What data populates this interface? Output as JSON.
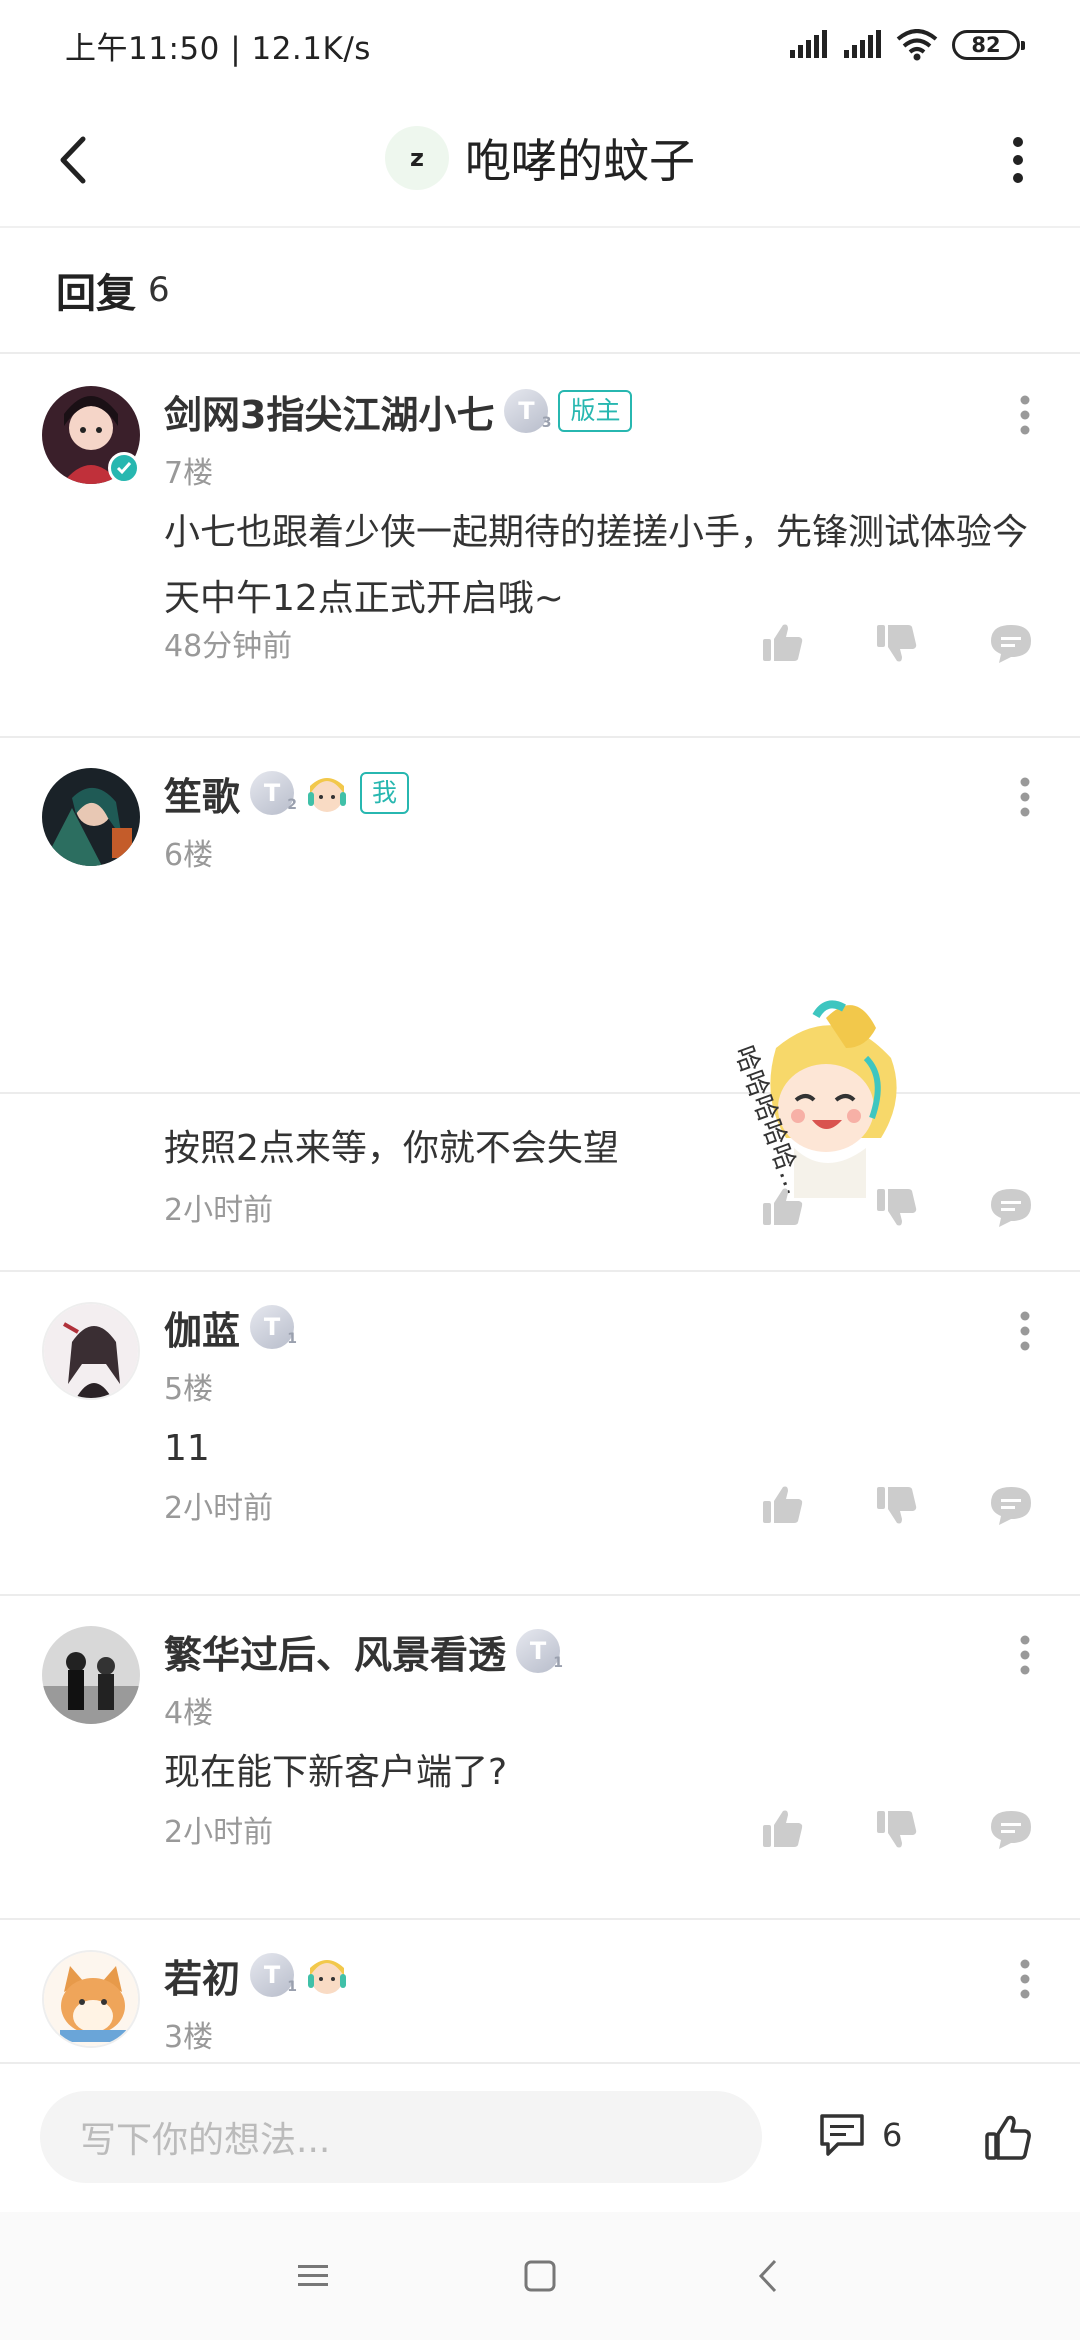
{
  "status_bar": {
    "time_speed": "上午11:50 | 12.1K/s",
    "battery": "82"
  },
  "header": {
    "avatar_letter": "z",
    "title": "咆哮的蚊子"
  },
  "reply_bar": {
    "label": "回复",
    "count": "6"
  },
  "comments": [
    {
      "name": "剑网3指尖江湖小七",
      "level": "3",
      "tag": "版主",
      "floor": "7楼",
      "text": "小七也跟着少侠一起期待的搓搓小手，先锋测试体验今天中午12点正式开启哦~",
      "time": "48分钟前"
    },
    {
      "name": "笙歌",
      "level": "2",
      "tag": "我",
      "floor": "6楼",
      "text": "按照2点来等，你就不会失望",
      "sticker_text": "哈哈哈哈哈…",
      "time": "2小时前"
    },
    {
      "name": "伽蓝",
      "level": "1",
      "floor": "5楼",
      "text": "11",
      "time": "2小时前"
    },
    {
      "name": "繁华过后、风景看透",
      "level": "1",
      "floor": "4楼",
      "text": "现在能下新客户端了?",
      "time": "2小时前"
    },
    {
      "name": "若初",
      "level": "1",
      "floor": "3楼"
    }
  ],
  "input_bar": {
    "placeholder": "写下你的想法...",
    "comment_count": "6"
  },
  "colors": {
    "accent": "#27b7b0",
    "text_primary": "#333333",
    "text_secondary": "#999999",
    "icon_gray": "#cccccc"
  }
}
